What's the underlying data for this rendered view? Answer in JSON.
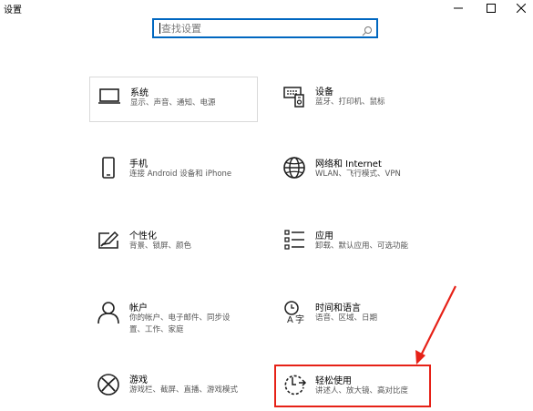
{
  "window": {
    "title": "设置",
    "controls": {
      "minimize": "minimize-icon",
      "maximize": "maximize-icon",
      "close": "close-icon"
    }
  },
  "search": {
    "placeholder": "查找设置",
    "value": ""
  },
  "colors": {
    "accent": "#0067c0",
    "highlight": "#e62117"
  },
  "tiles": [
    {
      "title": "系统",
      "subtitle": [
        "显示、声音、通知、电源"
      ],
      "icon": "display-icon"
    },
    {
      "title": "设备",
      "subtitle": [
        "蓝牙、打印机、鼠标"
      ],
      "icon": "keyboard-devices-icon"
    },
    {
      "title": "手机",
      "subtitle": [
        "连接 Android 设备和 iPhone"
      ],
      "icon": "phone-icon"
    },
    {
      "title": "网络和 Internet",
      "subtitle": [
        "WLAN、飞行模式、VPN"
      ],
      "icon": "globe-icon"
    },
    {
      "title": "个性化",
      "subtitle": [
        "背景、锁屏、颜色"
      ],
      "icon": "paint-icon"
    },
    {
      "title": "应用",
      "subtitle": [
        "卸载、默认应用、可选功能"
      ],
      "icon": "apps-list-icon"
    },
    {
      "title": "帐户",
      "subtitle": [
        "你的帐户、电子邮件、同步设",
        "置、工作、家庭"
      ],
      "icon": "person-icon"
    },
    {
      "title": "时间和语言",
      "subtitle": [
        "语音、区域、日期"
      ],
      "icon": "time-language-icon"
    },
    {
      "title": "游戏",
      "subtitle": [
        "游戏栏、截屏、直播、游戏模式"
      ],
      "icon": "xbox-icon"
    },
    {
      "title": "轻松使用",
      "subtitle": [
        "讲述人、放大镜、高对比度"
      ],
      "icon": "ease-of-access-icon"
    }
  ]
}
